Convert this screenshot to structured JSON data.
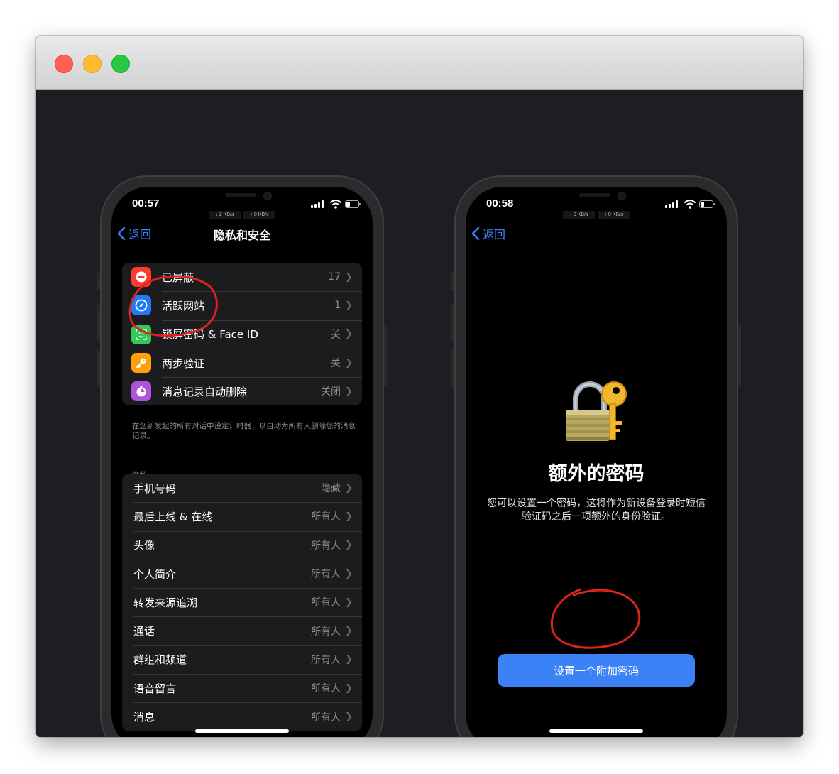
{
  "window": {
    "traffic_lights": [
      {
        "name": "close",
        "color": "#fe5f57"
      },
      {
        "name": "minimize",
        "color": "#febc2e"
      },
      {
        "name": "zoom",
        "color": "#28c840"
      }
    ]
  },
  "phone_left": {
    "status": {
      "time": "00:57",
      "down_speed": "↓ 2 KB/s",
      "up_speed": "↑ 0 KB/s"
    },
    "back_label": "返回",
    "title": "隐私和安全",
    "security_items": [
      {
        "label": "已屏蔽",
        "value": "17",
        "icon": "hand-block-icon",
        "color": "#ff3b30"
      },
      {
        "label": "活跃网站",
        "value": "1",
        "icon": "compass-icon",
        "color": "#1f7cf5"
      },
      {
        "label": "锁屏密码 & Face ID",
        "value": "关",
        "icon": "face-id-icon",
        "color": "#34c759"
      },
      {
        "label": "两步验证",
        "value": "关",
        "icon": "key-icon",
        "color": "#ff9f0a"
      },
      {
        "label": "消息记录自动删除",
        "value": "关闭",
        "icon": "timer-icon",
        "color": "#af52de"
      }
    ],
    "security_footnote": "在您新发起的所有对话中设定计时器，以自动为所有人删除您的消息记录。",
    "privacy_header": "隐私",
    "privacy_items": [
      {
        "label": "手机号码",
        "value": "隐藏"
      },
      {
        "label": "最后上线 & 在线",
        "value": "所有人"
      },
      {
        "label": "头像",
        "value": "所有人"
      },
      {
        "label": "个人简介",
        "value": "所有人"
      },
      {
        "label": "转发来源追溯",
        "value": "所有人"
      },
      {
        "label": "通话",
        "value": "所有人"
      },
      {
        "label": "群组和频道",
        "value": "所有人"
      },
      {
        "label": "语音留言",
        "value": "所有人"
      },
      {
        "label": "消息",
        "value": "所有人"
      }
    ]
  },
  "phone_right": {
    "status": {
      "time": "00:58",
      "down_speed": "↓ 0 KB/s",
      "up_speed": "↑ 0 KB/s"
    },
    "back_label": "返回",
    "illustration": "padlock-key-icon",
    "heading": "额外的密码",
    "description": "您可以设置一个密码，这将作为新设备登录时短信验证码之后一项额外的身份验证。",
    "button_label": "设置一个附加密码"
  },
  "annotation_color": "#d9231c"
}
